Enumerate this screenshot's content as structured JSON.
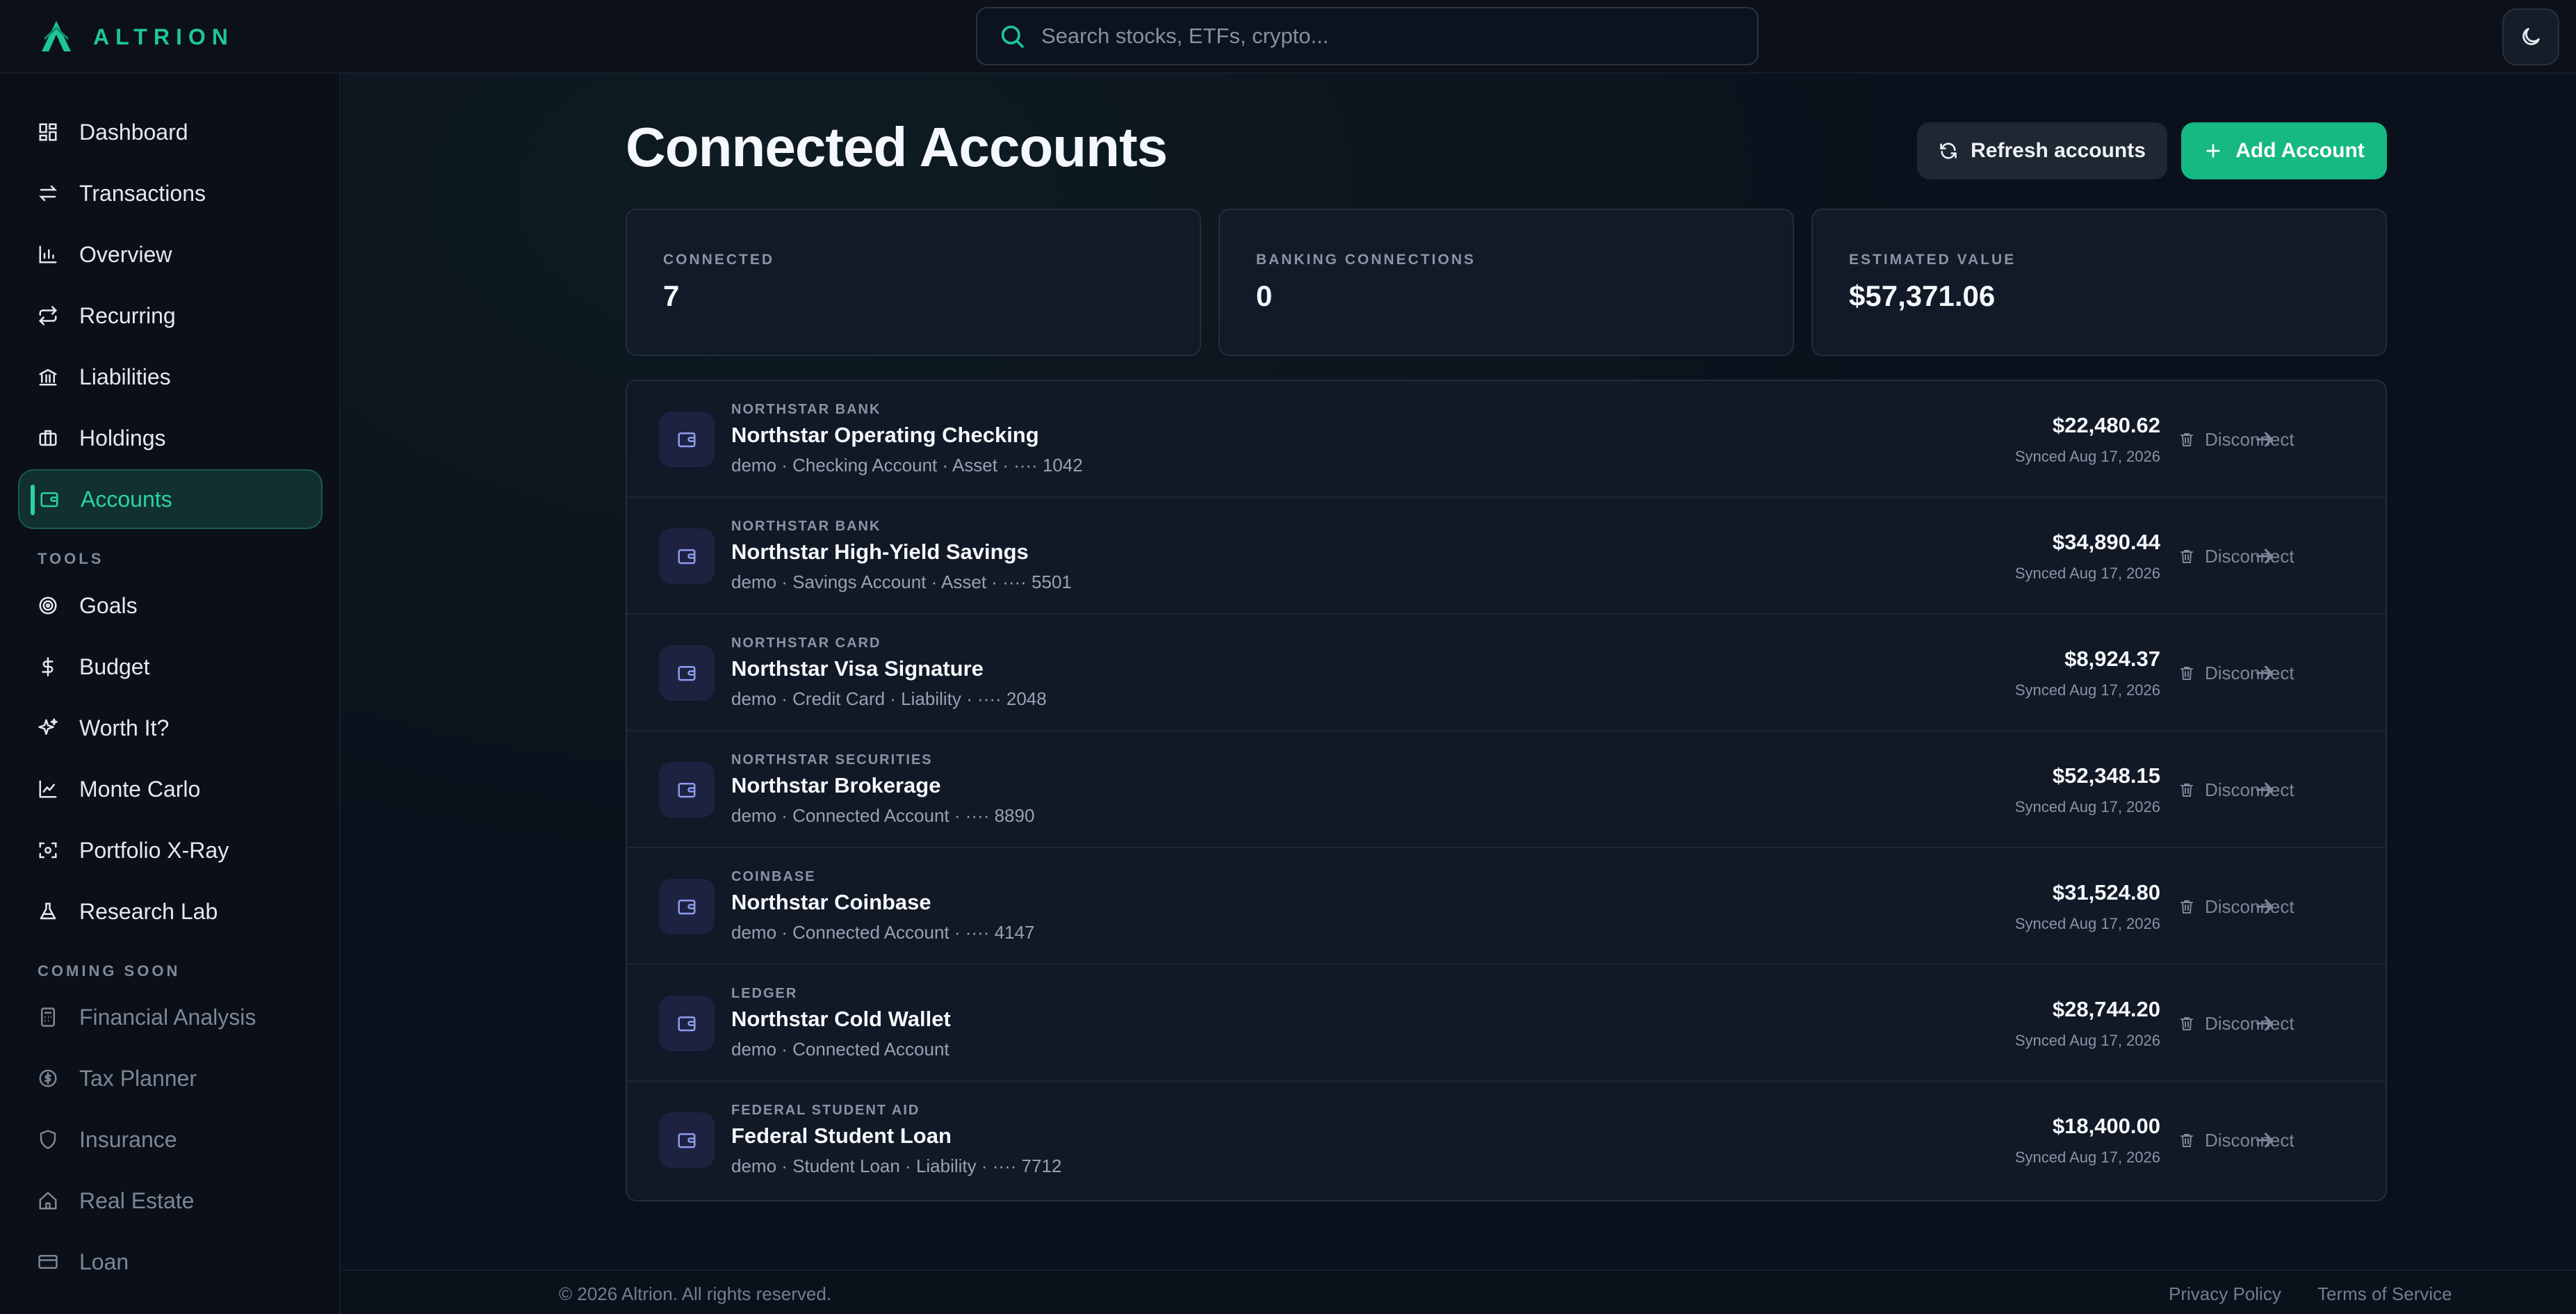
{
  "app": {
    "name": "ALTRION",
    "accent": "#1fc59a"
  },
  "search": {
    "placeholder": "Search stocks, ETFs, crypto..."
  },
  "sidebar": {
    "main_items": [
      {
        "label": "Dashboard",
        "icon": "dashboard-icon"
      },
      {
        "label": "Transactions",
        "icon": "transactions-icon"
      },
      {
        "label": "Overview",
        "icon": "bar-chart-icon"
      },
      {
        "label": "Recurring",
        "icon": "recurring-icon"
      },
      {
        "label": "Liabilities",
        "icon": "bank-icon"
      },
      {
        "label": "Holdings",
        "icon": "briefcase-icon"
      },
      {
        "label": "Accounts",
        "icon": "wallet-icon",
        "active": true
      }
    ],
    "tools_label": "TOOLS",
    "tools_items": [
      {
        "label": "Goals",
        "icon": "target-icon"
      },
      {
        "label": "Budget",
        "icon": "dollar-icon"
      },
      {
        "label": "Worth It?",
        "icon": "sparkles-icon"
      },
      {
        "label": "Monte Carlo",
        "icon": "line-chart-icon"
      },
      {
        "label": "Portfolio X-Ray",
        "icon": "scan-icon"
      },
      {
        "label": "Research Lab",
        "icon": "flask-icon"
      }
    ],
    "coming_soon_label": "COMING SOON",
    "coming_soon_items": [
      {
        "label": "Financial Analysis",
        "icon": "calculator-icon"
      },
      {
        "label": "Tax Planner",
        "icon": "coin-icon"
      },
      {
        "label": "Insurance",
        "icon": "shield-icon"
      },
      {
        "label": "Real Estate",
        "icon": "house-icon"
      },
      {
        "label": "Loan",
        "icon": "card-icon"
      }
    ]
  },
  "page": {
    "title": "Connected Accounts",
    "refresh_label": "Refresh accounts",
    "add_label": "Add Account"
  },
  "stats": [
    {
      "label": "CONNECTED",
      "value": "7"
    },
    {
      "label": "BANKING CONNECTIONS",
      "value": "0"
    },
    {
      "label": "ESTIMATED VALUE",
      "value": "$57,371.06"
    }
  ],
  "accounts": [
    {
      "institution": "NORTHSTAR BANK",
      "name": "Northstar Operating Checking",
      "meta": "demo · Checking Account · Asset · ···· 1042",
      "amount": "$22,480.62",
      "synced": "Synced Aug 17, 2026",
      "disconnect_label": "Disconnect"
    },
    {
      "institution": "NORTHSTAR BANK",
      "name": "Northstar High-Yield Savings",
      "meta": "demo · Savings Account · Asset · ···· 5501",
      "amount": "$34,890.44",
      "synced": "Synced Aug 17, 2026",
      "disconnect_label": "Disconnect"
    },
    {
      "institution": "NORTHSTAR CARD",
      "name": "Northstar Visa Signature",
      "meta": "demo · Credit Card · Liability · ···· 2048",
      "amount": "$8,924.37",
      "synced": "Synced Aug 17, 2026",
      "disconnect_label": "Disconnect"
    },
    {
      "institution": "NORTHSTAR SECURITIES",
      "name": "Northstar Brokerage",
      "meta": "demo · Connected Account · ···· 8890",
      "amount": "$52,348.15",
      "synced": "Synced Aug 17, 2026",
      "disconnect_label": "Disconnect"
    },
    {
      "institution": "COINBASE",
      "name": "Northstar Coinbase",
      "meta": "demo · Connected Account · ···· 4147",
      "amount": "$31,524.80",
      "synced": "Synced Aug 17, 2026",
      "disconnect_label": "Disconnect"
    },
    {
      "institution": "LEDGER",
      "name": "Northstar Cold Wallet",
      "meta": "demo · Connected Account",
      "amount": "$28,744.20",
      "synced": "Synced Aug 17, 2026",
      "disconnect_label": "Disconnect"
    },
    {
      "institution": "FEDERAL STUDENT AID",
      "name": "Federal Student Loan",
      "meta": "demo · Student Loan · Liability · ···· 7712",
      "amount": "$18,400.00",
      "synced": "Synced Aug 17, 2026",
      "disconnect_label": "Disconnect"
    }
  ],
  "footer": {
    "copyright": "© 2026 Altrion. All rights reserved.",
    "privacy": "Privacy Policy",
    "terms": "Terms of Service"
  }
}
